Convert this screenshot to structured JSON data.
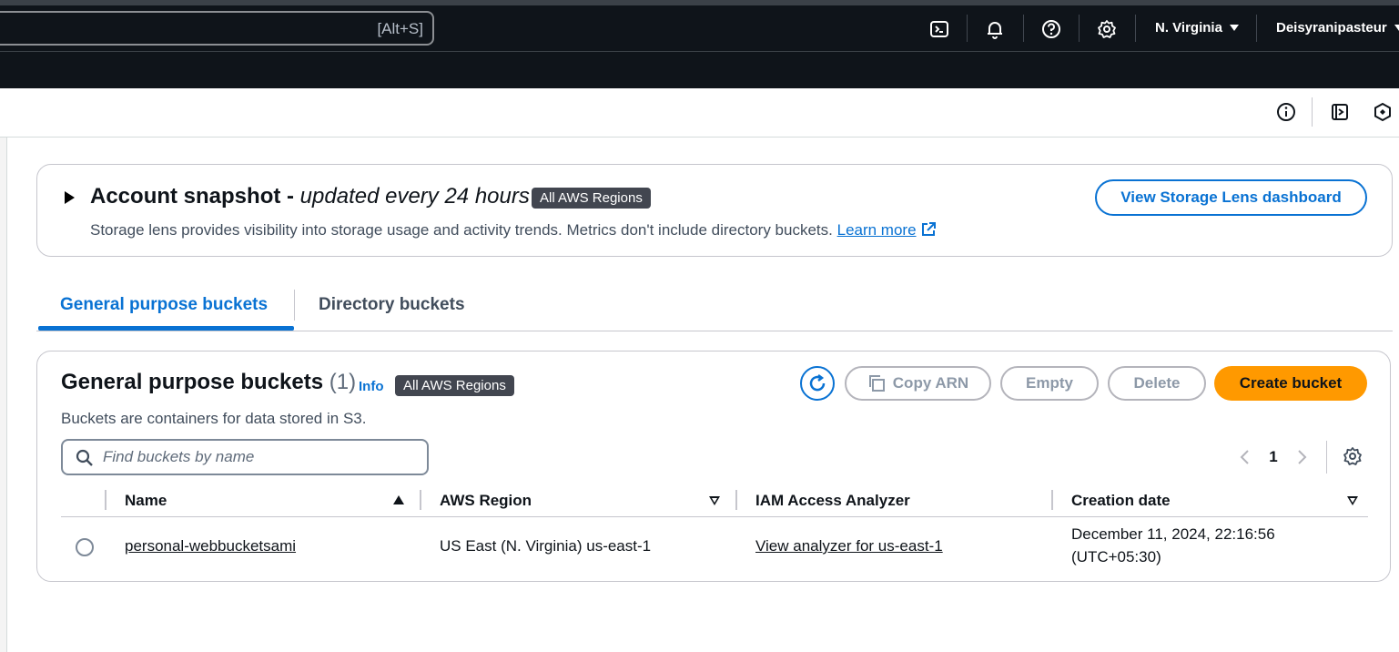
{
  "topbar": {
    "search_shortcut": "[Alt+S]",
    "region": "N. Virginia",
    "account": "Deisyranipasteur"
  },
  "snapshot": {
    "title": "Account snapshot",
    "title_dash": " - ",
    "title_italic": "updated every 24 hours",
    "badge": "All AWS Regions",
    "description": "Storage lens provides visibility into storage usage and activity trends. Metrics don't include directory buckets.",
    "learn_more": "Learn more",
    "view_button": "View Storage Lens dashboard"
  },
  "tabs": [
    {
      "label": "General purpose buckets"
    },
    {
      "label": "Directory buckets"
    }
  ],
  "buckets": {
    "title": "General purpose buckets",
    "count": "(1)",
    "info": "Info",
    "badge": "All AWS Regions",
    "description": "Buckets are containers for data stored in S3.",
    "copy_arn": "Copy ARN",
    "empty": "Empty",
    "delete": "Delete",
    "create": "Create bucket",
    "search_placeholder": "Find buckets by name",
    "page": "1",
    "columns": [
      "Name",
      "AWS Region",
      "IAM Access Analyzer",
      "Creation date"
    ],
    "rows": [
      {
        "name": "personal-webbucketsami",
        "region": "US East (N. Virginia) us-east-1",
        "analyzer": "View analyzer for us-east-1",
        "created_line1": "December 11, 2024, 22:16:56",
        "created_line2": "(UTC+05:30)"
      }
    ]
  },
  "colors": {
    "accent": "#0972d3",
    "primary_button": "#ff9900",
    "header_bg": "#0f141a"
  }
}
